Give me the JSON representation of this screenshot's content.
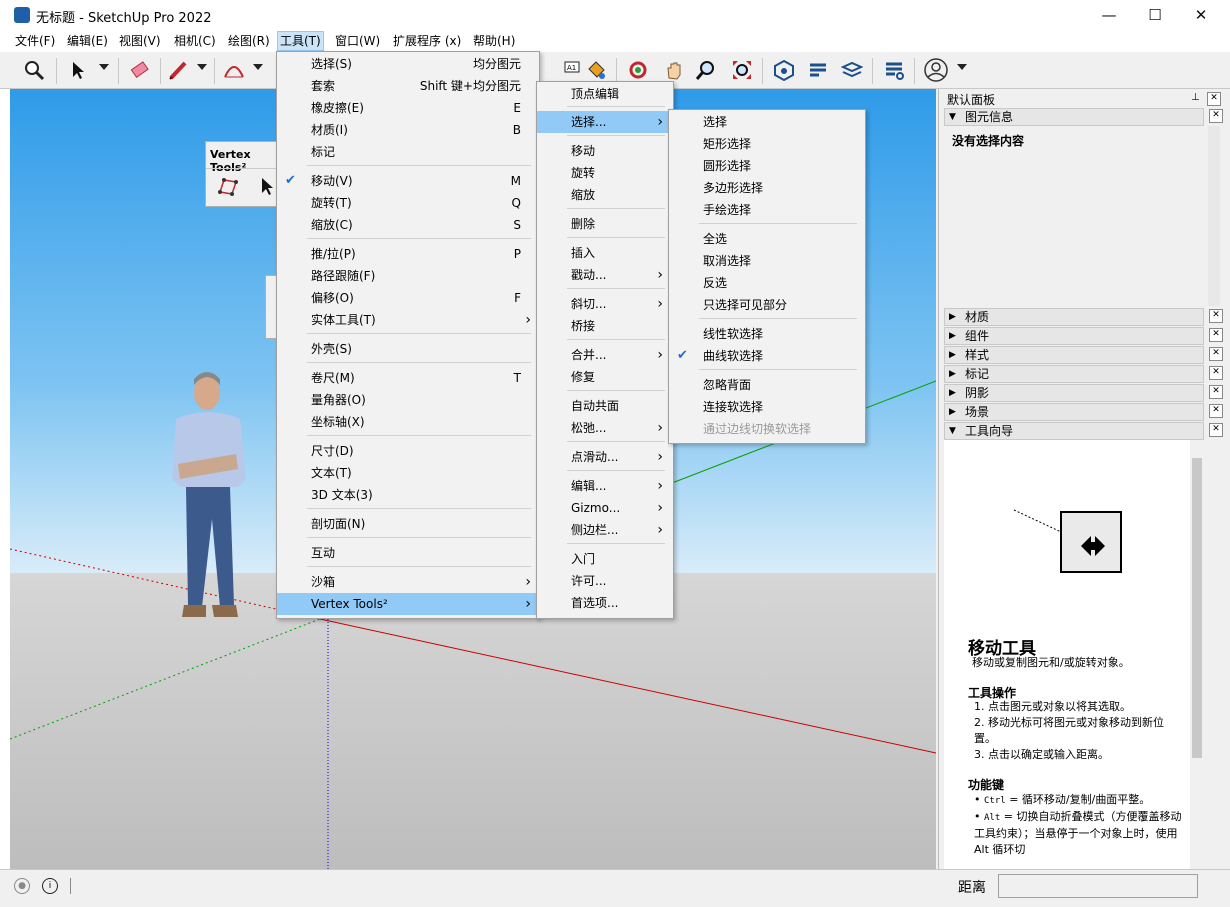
{
  "window": {
    "title": "无标题 - SketchUp Pro 2022",
    "min": "—",
    "max": "☐",
    "close": "✕"
  },
  "menubar": [
    "文件(F)",
    "编辑(E)",
    "视图(V)",
    "相机(C)",
    "绘图(R)",
    "工具(T)",
    "窗口(W)",
    "扩展程序 (x)",
    "帮助(H)"
  ],
  "vertex_toolbar": {
    "title": "Vertex Tools²"
  },
  "tools_menu": [
    {
      "label": "选择(S)",
      "shortcut": "均分图元"
    },
    {
      "label": "套索",
      "shortcut": "Shift 键+均分图元"
    },
    {
      "label": "橡皮擦(E)",
      "shortcut": "E"
    },
    {
      "label": "材质(I)",
      "shortcut": "B"
    },
    {
      "label": "标记",
      "shortcut": ""
    },
    {
      "label": "移动(V)",
      "shortcut": "M",
      "checked": true
    },
    {
      "label": "旋转(T)",
      "shortcut": "Q"
    },
    {
      "label": "缩放(C)",
      "shortcut": "S"
    },
    {
      "label": "推/拉(P)",
      "shortcut": "P"
    },
    {
      "label": "路径跟随(F)",
      "shortcut": ""
    },
    {
      "label": "偏移(O)",
      "shortcut": "F"
    },
    {
      "label": "实体工具(T)",
      "submenu": true
    },
    {
      "label": "外壳(S)"
    },
    {
      "label": "卷尺(M)",
      "shortcut": "T"
    },
    {
      "label": "量角器(O)"
    },
    {
      "label": "坐标轴(X)"
    },
    {
      "label": "尺寸(D)"
    },
    {
      "label": "文本(T)"
    },
    {
      "label": "3D 文本(3)"
    },
    {
      "label": "剖切面(N)"
    },
    {
      "label": "互动"
    },
    {
      "label": "沙箱",
      "submenu": true
    },
    {
      "label": "Vertex Tools²",
      "submenu": true,
      "highlighted": true
    }
  ],
  "vertex_menu": [
    {
      "label": "顶点编辑"
    },
    {
      "label": "选择...",
      "submenu": true,
      "highlighted": true
    },
    {
      "label": "移动"
    },
    {
      "label": "旋转"
    },
    {
      "label": "缩放"
    },
    {
      "label": "删除"
    },
    {
      "label": "插入"
    },
    {
      "label": "戳动...",
      "submenu": true
    },
    {
      "label": "斜切...",
      "submenu": true
    },
    {
      "label": "桥接"
    },
    {
      "label": "合并...",
      "submenu": true
    },
    {
      "label": "修复"
    },
    {
      "label": "自动共面"
    },
    {
      "label": "松弛...",
      "submenu": true
    },
    {
      "label": "点滑动...",
      "submenu": true
    },
    {
      "label": "编辑...",
      "submenu": true
    },
    {
      "label": "Gizmo...",
      "submenu": true
    },
    {
      "label": "侧边栏...",
      "submenu": true
    },
    {
      "label": "入门"
    },
    {
      "label": "许可..."
    },
    {
      "label": "首选项..."
    }
  ],
  "select_menu": [
    {
      "label": "选择"
    },
    {
      "label": "矩形选择"
    },
    {
      "label": "圆形选择"
    },
    {
      "label": "多边形选择"
    },
    {
      "label": "手绘选择"
    },
    {
      "label": "全选"
    },
    {
      "label": "取消选择"
    },
    {
      "label": "反选"
    },
    {
      "label": "只选择可见部分"
    },
    {
      "label": "线性软选择"
    },
    {
      "label": "曲线软选择",
      "checked": true
    },
    {
      "label": "忽略背面"
    },
    {
      "label": "连接软选择"
    },
    {
      "label": "通过边线切换软选择",
      "disabled": true
    }
  ],
  "panel": {
    "title": "默认面板",
    "entity_info": {
      "header": "图元信息",
      "content": "没有选择内容"
    },
    "trays": [
      "材质",
      "组件",
      "样式",
      "标记",
      "阴影",
      "场景"
    ],
    "instructor": {
      "header": "工具向导",
      "tool_title": "移动工具",
      "tool_desc": "移动或复制图元和/或旋转对象。",
      "ops_title": "工具操作",
      "ops": [
        "点击图元或对象以将其选取。",
        "移动光标可将图元或对象移动到新位置。",
        "点击以确定或输入距离。"
      ],
      "keys_title": "功能键",
      "keys": [
        {
          "key": "Ctrl",
          "text": "= 循环移动/复制/曲面平整。"
        },
        {
          "key": "Alt",
          "text": "= 切换自动折叠模式（方便覆盖移动工具约束）；当悬停于一个对象上时，使用 Alt 循环切"
        }
      ]
    }
  },
  "status": {
    "distance_label": "距离",
    "distance_value": ""
  },
  "colors": {
    "menu_highlight": "#91c9f7",
    "check": "#1c6fd1",
    "red_axis": "#cc0000",
    "green_axis": "#00a000"
  }
}
